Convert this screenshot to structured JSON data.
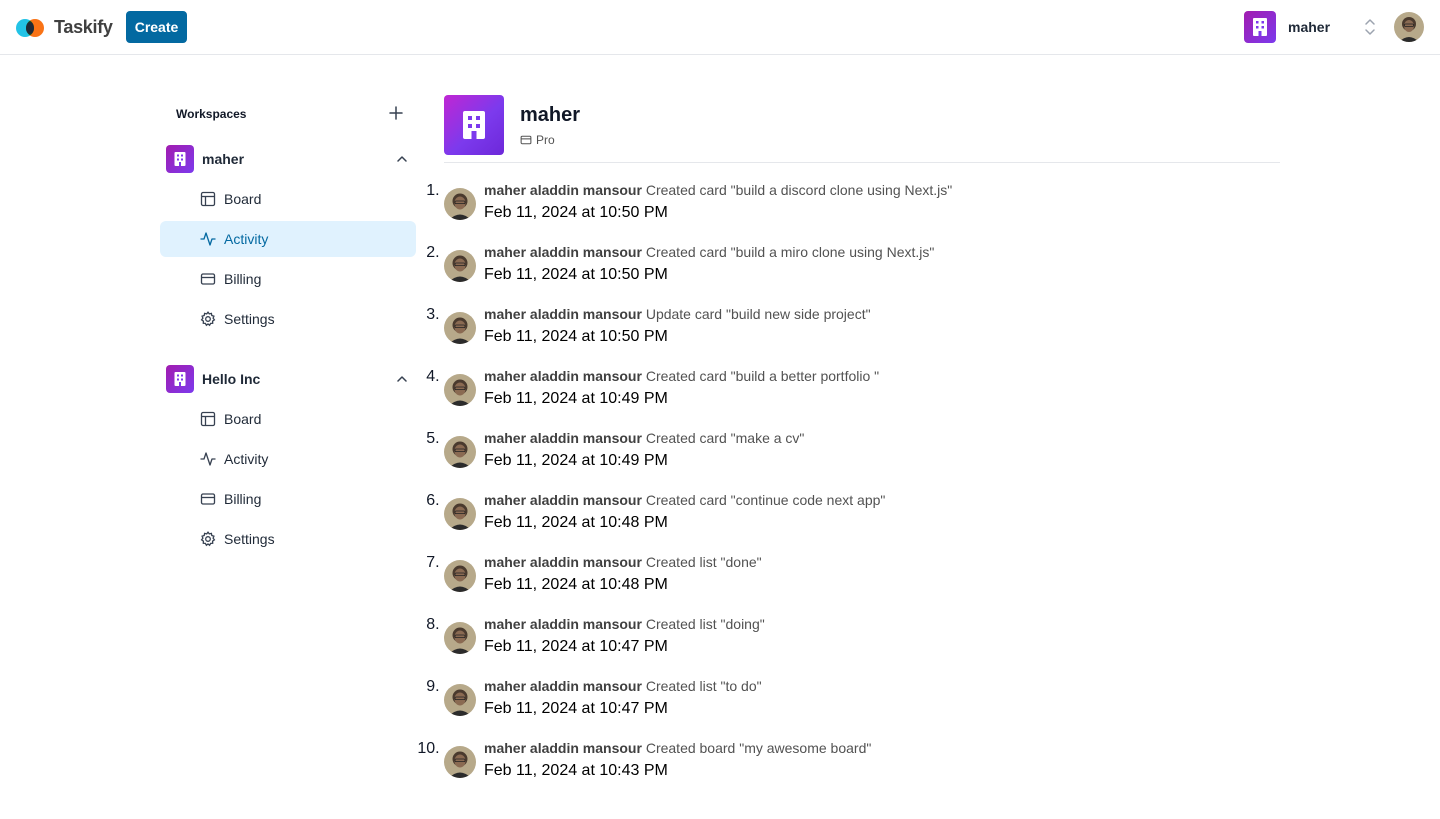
{
  "app": {
    "brand": "Taskify",
    "create_label": "Create",
    "brand_colors": {
      "primary": "#0369a1",
      "workspace_gradient_start": "#a21caf",
      "workspace_gradient_end": "#7c3aed",
      "active_bg": "#e0f2fe"
    }
  },
  "topbar": {
    "org_name": "maher",
    "org_icon": "building-icon",
    "switcher_icon": "chevrons-up-down-icon",
    "user_avatar": "user-avatar-photo"
  },
  "sidebar": {
    "header": "Workspaces",
    "add_icon": "plus-icon",
    "workspaces": [
      {
        "name": "maher",
        "expanded": true,
        "items": [
          {
            "label": "Board",
            "icon": "layout-icon",
            "active": false
          },
          {
            "label": "Activity",
            "icon": "activity-icon",
            "active": true
          },
          {
            "label": "Billing",
            "icon": "credit-card-icon",
            "active": false
          },
          {
            "label": "Settings",
            "icon": "settings-icon",
            "active": false
          }
        ]
      },
      {
        "name": "Hello Inc",
        "expanded": true,
        "items": [
          {
            "label": "Board",
            "icon": "layout-icon",
            "active": false
          },
          {
            "label": "Activity",
            "icon": "activity-icon",
            "active": false
          },
          {
            "label": "Billing",
            "icon": "credit-card-icon",
            "active": false
          },
          {
            "label": "Settings",
            "icon": "settings-icon",
            "active": false
          }
        ]
      }
    ]
  },
  "main": {
    "title": "maher",
    "plan": "Pro",
    "activities": [
      {
        "user": "maher aladdin mansour",
        "action": "Created card \"build a discord clone using Next.js\"",
        "time": "Feb 11, 2024 at 10:50 PM"
      },
      {
        "user": "maher aladdin mansour",
        "action": "Created card \"build a miro clone using Next.js\"",
        "time": "Feb 11, 2024 at 10:50 PM"
      },
      {
        "user": "maher aladdin mansour",
        "action": "Update card \"build new side project\"",
        "time": "Feb 11, 2024 at 10:50 PM"
      },
      {
        "user": "maher aladdin mansour",
        "action": "Created card \"build a better portfolio \"",
        "time": "Feb 11, 2024 at 10:49 PM"
      },
      {
        "user": "maher aladdin mansour",
        "action": "Created card \"make a cv\"",
        "time": "Feb 11, 2024 at 10:49 PM"
      },
      {
        "user": "maher aladdin mansour",
        "action": "Created card \"continue code next app\"",
        "time": "Feb 11, 2024 at 10:48 PM"
      },
      {
        "user": "maher aladdin mansour",
        "action": "Created list \"done\"",
        "time": "Feb 11, 2024 at 10:48 PM"
      },
      {
        "user": "maher aladdin mansour",
        "action": "Created list \"doing\"",
        "time": "Feb 11, 2024 at 10:47 PM"
      },
      {
        "user": "maher aladdin mansour",
        "action": "Created list \"to do\"",
        "time": "Feb 11, 2024 at 10:47 PM"
      },
      {
        "user": "maher aladdin mansour",
        "action": "Created board \"my awesome board\"",
        "time": "Feb 11, 2024 at 10:43 PM"
      }
    ]
  }
}
